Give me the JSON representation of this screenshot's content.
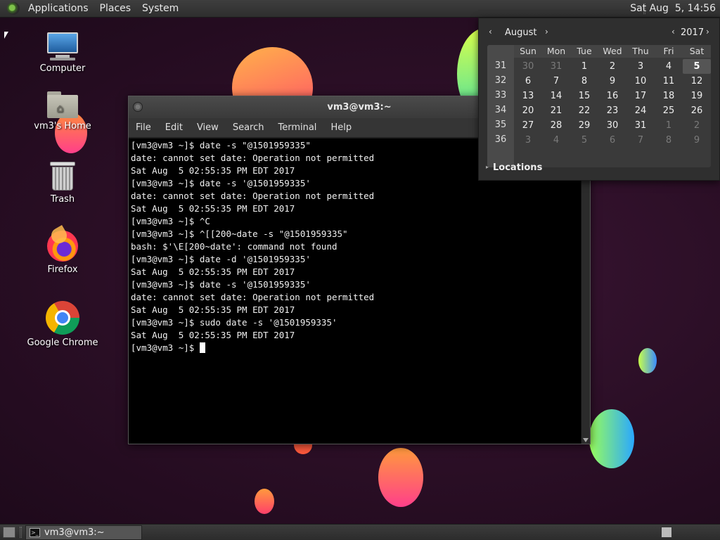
{
  "top_panel": {
    "applications": "Applications",
    "places": "Places",
    "system": "System",
    "clock": "Sat Aug  5, 14:56"
  },
  "desktop": {
    "icons": [
      {
        "label": "Computer",
        "icon": "computer-icon"
      },
      {
        "label": "vm3's Home",
        "icon": "home-folder-icon"
      },
      {
        "label": "Trash",
        "icon": "trash-icon"
      },
      {
        "label": "Firefox",
        "icon": "firefox-icon"
      },
      {
        "label": "Google Chrome",
        "icon": "chrome-icon"
      }
    ]
  },
  "terminal": {
    "title": "vm3@vm3:~",
    "menu": [
      "File",
      "Edit",
      "View",
      "Search",
      "Terminal",
      "Help"
    ],
    "lines": [
      "[vm3@vm3 ~]$ date -s \"@1501959335\"",
      "date: cannot set date: Operation not permitted",
      "Sat Aug  5 02:55:35 PM EDT 2017",
      "[vm3@vm3 ~]$ date -s '@1501959335'",
      "date: cannot set date: Operation not permitted",
      "Sat Aug  5 02:55:35 PM EDT 2017",
      "[vm3@vm3 ~]$ ^C",
      "[vm3@vm3 ~]$ ^[[200~date -s \"@1501959335\"",
      "bash: $'\\E[200~date': command not found",
      "[vm3@vm3 ~]$ date -d '@1501959335'",
      "Sat Aug  5 02:55:35 PM EDT 2017",
      "[vm3@vm3 ~]$ date -s '@1501959335'",
      "date: cannot set date: Operation not permitted",
      "Sat Aug  5 02:55:35 PM EDT 2017",
      "[vm3@vm3 ~]$ sudo date -s '@1501959335'",
      "Sat Aug  5 02:55:35 PM EDT 2017"
    ],
    "prompt": "[vm3@vm3 ~]$ "
  },
  "calendar": {
    "month": "August",
    "year": "2017",
    "days_of_week": [
      "Sun",
      "Mon",
      "Tue",
      "Wed",
      "Thu",
      "Fri",
      "Sat"
    ],
    "week_numbers": [
      "31",
      "32",
      "33",
      "34",
      "35",
      "36"
    ],
    "weeks": [
      [
        "30",
        "31",
        "1",
        "2",
        "3",
        "4",
        "5"
      ],
      [
        "6",
        "7",
        "8",
        "9",
        "10",
        "11",
        "12"
      ],
      [
        "13",
        "14",
        "15",
        "16",
        "17",
        "18",
        "19"
      ],
      [
        "20",
        "21",
        "22",
        "23",
        "24",
        "25",
        "26"
      ],
      [
        "27",
        "28",
        "29",
        "30",
        "31",
        "1",
        "2"
      ],
      [
        "3",
        "4",
        "5",
        "6",
        "7",
        "8",
        "9"
      ]
    ],
    "today": "5",
    "locations_label": "Locations"
  },
  "bottom_panel": {
    "task_label": "vm3@vm3:~"
  }
}
